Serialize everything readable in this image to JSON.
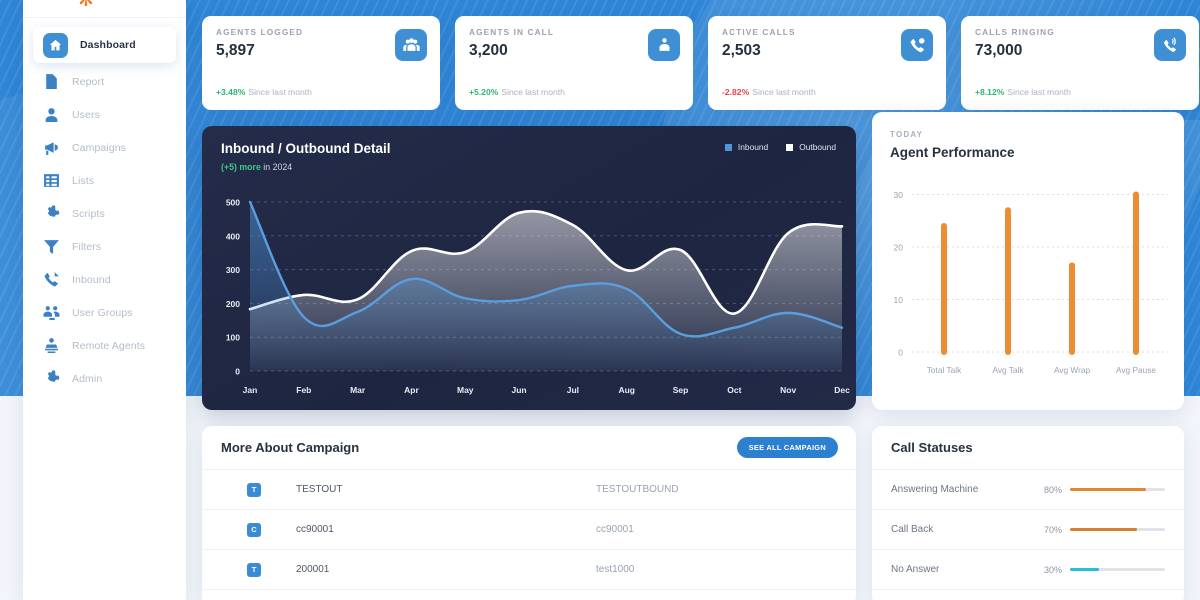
{
  "sidebar": {
    "logo_icon": "orange-star-logo",
    "items": [
      {
        "label": "Dashboard",
        "icon": "home-icon",
        "active": true
      },
      {
        "label": "Report",
        "icon": "file-icon",
        "active": false
      },
      {
        "label": "Users",
        "icon": "user-icon",
        "active": false
      },
      {
        "label": "Campaigns",
        "icon": "megaphone-icon",
        "active": false
      },
      {
        "label": "Lists",
        "icon": "list-icon",
        "active": false
      },
      {
        "label": "Scripts",
        "icon": "gear-icon",
        "active": false
      },
      {
        "label": "Filters",
        "icon": "funnel-icon",
        "active": false
      },
      {
        "label": "Inbound",
        "icon": "phone-incoming-icon",
        "active": false
      },
      {
        "label": "User Groups",
        "icon": "users-group-icon",
        "active": false
      },
      {
        "label": "Remote Agents",
        "icon": "remote-agent-icon",
        "active": false
      },
      {
        "label": "Admin",
        "icon": "cog-icon",
        "active": false
      }
    ]
  },
  "stats": [
    {
      "label": "AGENTS LOGGED",
      "value": "5,897",
      "delta": "+3.48%",
      "delta_dir": "up",
      "since": "Since last month",
      "icon": "people-group-icon"
    },
    {
      "label": "AGENTS IN CALL",
      "value": "3,200",
      "delta": "+5.20%",
      "delta_dir": "up",
      "since": "Since last month",
      "icon": "person-badge-icon"
    },
    {
      "label": "ACTIVE CALLS",
      "value": "2,503",
      "delta": "-2.82%",
      "delta_dir": "down",
      "since": "Since last month",
      "icon": "phone-active-icon"
    },
    {
      "label": "CALLS RINGING",
      "value": "73,000",
      "delta": "+8.12%",
      "delta_dir": "up",
      "since": "Since last month",
      "icon": "phone-ringing-icon"
    }
  ],
  "line_chart": {
    "title": "Inbound / Outbound Detail",
    "sub_highlight": "(+5) more",
    "sub_rest": "in 2024",
    "legend": [
      {
        "name": "Inbound",
        "color": "#4e95d9"
      },
      {
        "name": "Outbound",
        "color": "#ffffff"
      }
    ]
  },
  "agent_chart": {
    "eyebrow": "TODAY",
    "title": "Agent Performance"
  },
  "campaign": {
    "title": "More About Campaign",
    "button": "SEE ALL CAMPAIGN",
    "rows": [
      {
        "badge": "T",
        "name": "TESTOUT",
        "alt": "TESTOUTBOUND"
      },
      {
        "badge": "C",
        "name": "cc90001",
        "alt": "cc90001"
      },
      {
        "badge": "T",
        "name": "200001",
        "alt": "test1000"
      }
    ]
  },
  "call_statuses": {
    "title": "Call Statuses",
    "rows": [
      {
        "name": "Answering Machine",
        "pct": "80%",
        "value": 80,
        "color": "#e2872f"
      },
      {
        "name": "Call Back",
        "pct": "70%",
        "value": 70,
        "color": "#d4822f"
      },
      {
        "name": "No Answer",
        "pct": "30%",
        "value": 30,
        "color": "#23c0d6"
      }
    ]
  },
  "chart_data": [
    {
      "type": "area",
      "title": "Inbound / Outbound Detail",
      "subtitle": "(+5) more in 2024",
      "xlabel": "",
      "ylabel": "",
      "ylim": [
        0,
        500
      ],
      "yticks": [
        0,
        100,
        200,
        300,
        400,
        500
      ],
      "grid": true,
      "legend_position": "top-right",
      "categories": [
        "Jan",
        "Feb",
        "Mar",
        "Apr",
        "May",
        "Jun",
        "Jul",
        "Aug",
        "Sep",
        "Oct",
        "Nov",
        "Dec"
      ],
      "series": [
        {
          "name": "Inbound",
          "color": "#4e95d9",
          "values": [
            500,
            160,
            175,
            272,
            215,
            210,
            252,
            243,
            110,
            128,
            172,
            128
          ]
        },
        {
          "name": "Outbound",
          "color": "#ffffff",
          "values": [
            183,
            225,
            212,
            355,
            352,
            468,
            432,
            298,
            358,
            170,
            408,
            428
          ]
        }
      ]
    },
    {
      "type": "bar",
      "title": "Agent Performance",
      "subtitle": "TODAY",
      "xlabel": "",
      "ylabel": "",
      "ylim": [
        0,
        32
      ],
      "yticks": [
        0,
        10,
        20,
        30
      ],
      "grid": true,
      "bar_color": "#ef8b33",
      "categories": [
        "Total Talk",
        "Avg Talk",
        "Avg Wrap",
        "Avg Pause"
      ],
      "values": [
        24,
        27,
        16.5,
        30
      ]
    },
    {
      "type": "bar",
      "title": "Call Statuses",
      "orientation": "horizontal",
      "xlim": [
        0,
        100
      ],
      "categories": [
        "Answering Machine",
        "Call Back",
        "No Answer"
      ],
      "values": [
        80,
        70,
        30
      ]
    }
  ]
}
